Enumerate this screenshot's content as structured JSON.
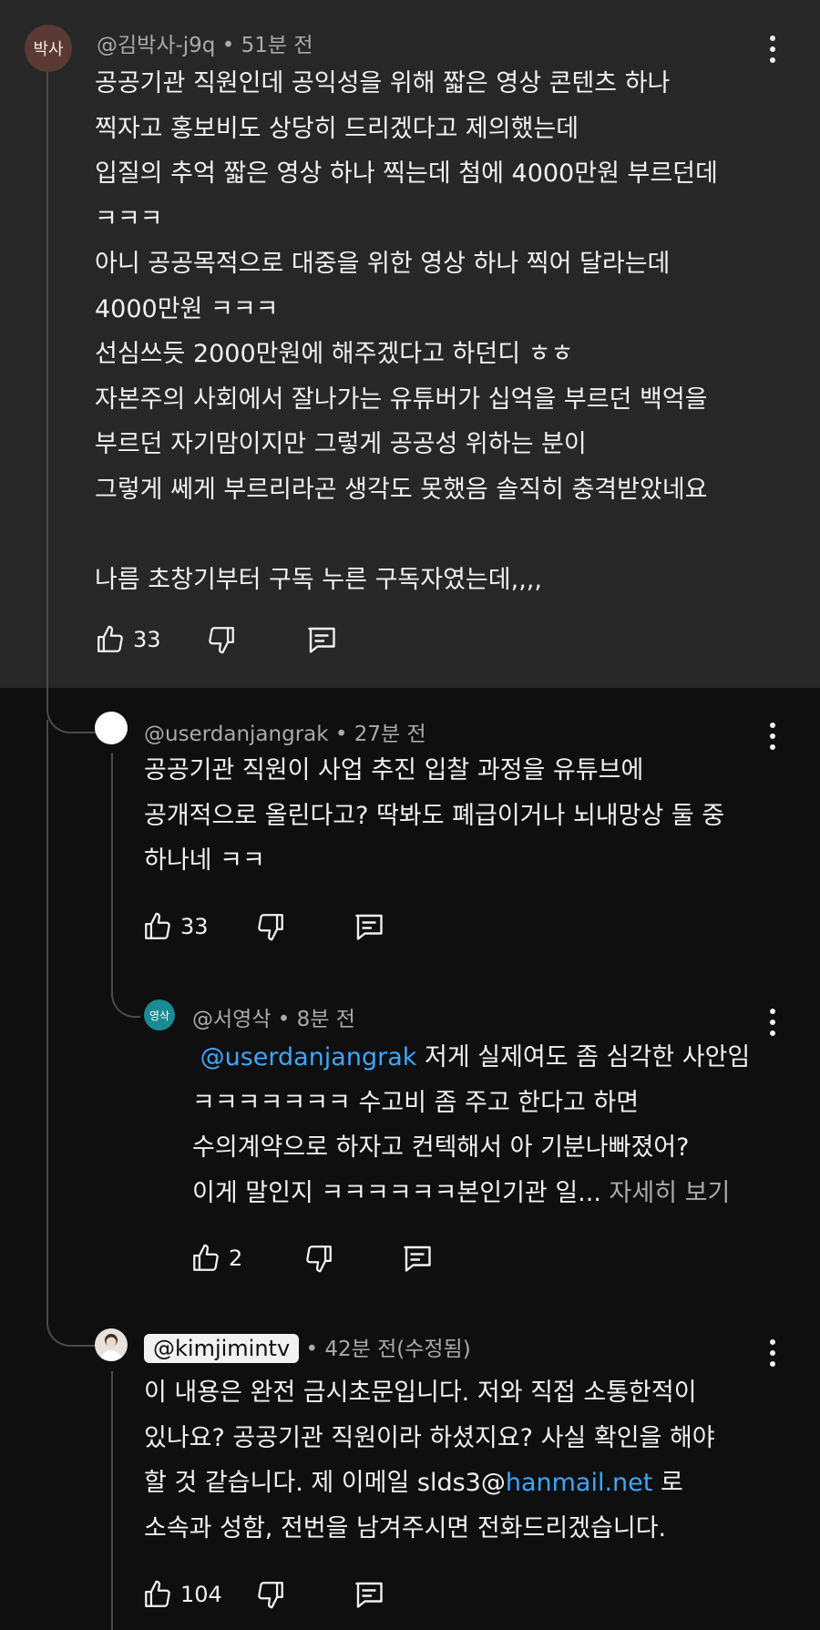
{
  "comments": [
    {
      "avatar_text": "박사",
      "author": "@김박사-j9q",
      "time": "• 51분 전",
      "lines": [
        "공공기관 직원인데 공익성을 위해 짧은 영상 콘텐츠 하나",
        "찍자고 홍보비도 상당히 드리겠다고 제의했는데",
        "입질의 추억 짧은 영상 하나 찍는데 첨에 4000만원 부르던데",
        "ㅋㅋㅋ",
        "아니 공공목적으로 대중을 위한 영상 하나 찍어 달라는데",
        "4000만원 ㅋㅋㅋ",
        "선심쓰듯 2000만원에 해주겠다고 하던디 ㅎㅎ",
        "자본주의 사회에서 잘나가는 유튜버가 십억을 부르던 백억을",
        "부르던 자기맘이지만 그렇게 공공성 위하는 분이",
        "그렇게 쎄게 부르리라곤 생각도 못했음 솔직히 충격받았네요",
        "",
        "나름 초창기부터 구독 누른 구독자였는데,,,,"
      ],
      "likes": "33"
    },
    {
      "author": "@userdanjangrak",
      "time": "• 27분 전",
      "lines": [
        "공공기관 직원이 사업 추진 입찰 과정을 유튜브에",
        "공개적으로 올린다고? 딱봐도 폐급이거나 뇌내망상 둘 중",
        "하나네 ㅋㅋ"
      ],
      "likes": "33"
    },
    {
      "avatar_text": "영삭",
      "author": "@서영삭",
      "time": "• 8분 전",
      "mention": "@userdanjangrak",
      "line1_rest": " 저게 실제여도 좀 심각한 사안임",
      "lines": [
        "ㅋㅋㅋㅋㅋㅋㅋ 수고비 좀 주고 한다고 하면",
        "수의계약으로 하자고 컨텍해서 아 기분나빠졌어?"
      ],
      "last_line": "이게 말인지 ㅋㅋㅋㅋㅋㅋ본인기관 일...",
      "read_more": "자세히 보기",
      "likes": "2"
    },
    {
      "author": "@kimjimintv",
      "time": "• 42분 전(수정됨)",
      "lines": [
        "이 내용은 완전 금시초문입니다. 저와 직접 소통한적이",
        "있나요? 공공기관 직원이라 하셨지요? 사실 확인을 해야"
      ],
      "line3_pre": "할 것 같습니다. 제 이메일 slds3@",
      "line3_link": "hanmail.net",
      "line3_post": " 로",
      "line4": "소속과 성함, 전번을 남겨주시면 전화드리겠습니다.",
      "likes": "104"
    }
  ],
  "icons": [
    "thumb-up-icon",
    "thumb-down-icon",
    "reply-icon",
    "more-vert-icon"
  ],
  "colors": {
    "top_bg": "#272727",
    "page_bg": "#0f0f0f",
    "link": "#3ea6ff",
    "meta": "#aaaaaa",
    "avatar1": "#5c3a34",
    "avatar3": "#1a8a93"
  }
}
